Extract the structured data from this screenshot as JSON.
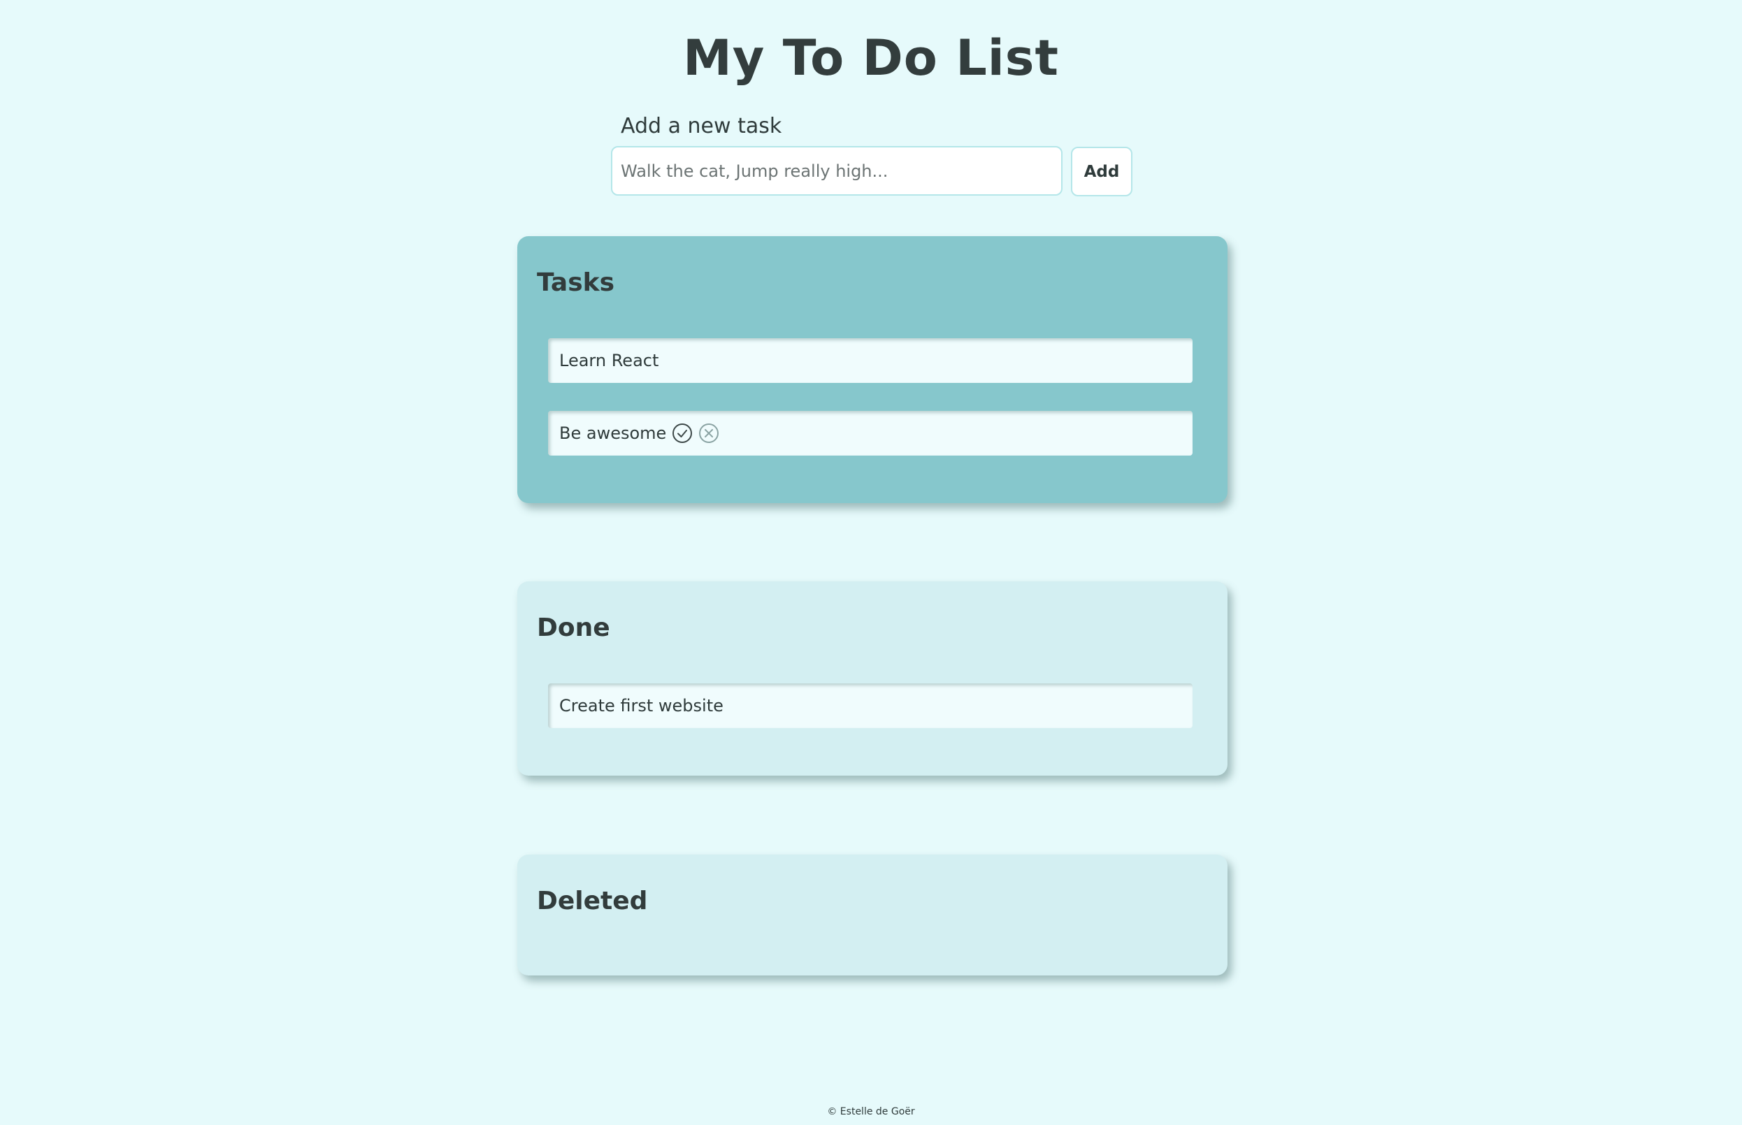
{
  "title": "My To Do List",
  "new_task": {
    "label": "Add a new task",
    "placeholder": "Walk the cat, Jump really high...",
    "value": "",
    "add_label": "Add"
  },
  "lists": {
    "tasks": {
      "heading": "Tasks",
      "items": [
        {
          "text": "Learn React"
        },
        {
          "text": "Be awesome",
          "actions": [
            "check-circle-icon",
            "close-circle-icon"
          ]
        }
      ]
    },
    "done": {
      "heading": "Done",
      "items": [
        {
          "text": "Create first website"
        }
      ]
    },
    "deleted": {
      "heading": "Deleted",
      "items": []
    }
  },
  "footer": "© Estelle de Goër",
  "colors": {
    "background": "#e6fafb",
    "tasks_panel": "#86c7cc",
    "secondary_panel": "#d3eff2",
    "item": "#f0fcfd",
    "input_border": "#b4e6e9",
    "text": "#2f3b3b"
  }
}
